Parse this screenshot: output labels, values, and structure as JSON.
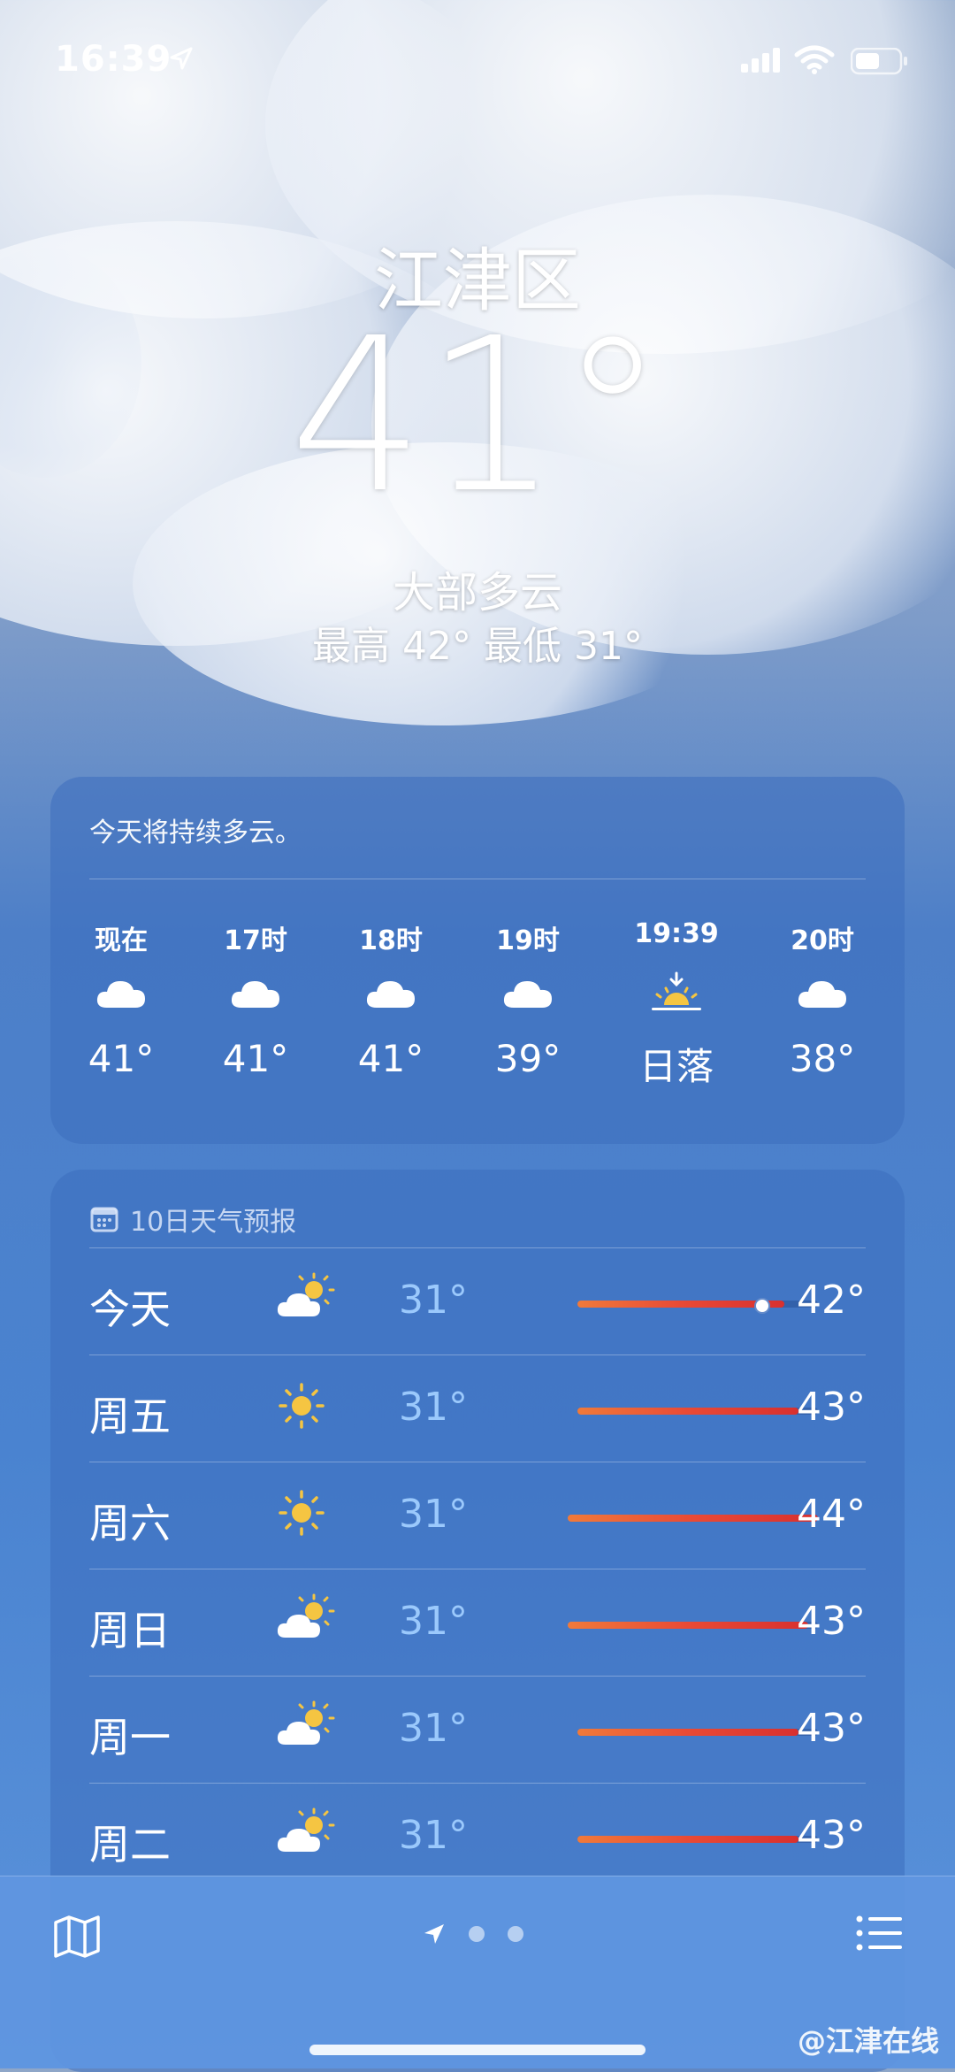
{
  "status_bar": {
    "time": "16:39"
  },
  "header": {
    "city": "江津区",
    "temperature": "41°",
    "condition": "大部多云",
    "high_low": "最高 42°  最低 31°"
  },
  "hourly": {
    "summary": "今天将持续多云。",
    "items": [
      {
        "label": "现在",
        "icon": "cloud-icon",
        "value": "41°"
      },
      {
        "label": "17时",
        "icon": "cloud-icon",
        "value": "41°"
      },
      {
        "label": "18时",
        "icon": "cloud-icon",
        "value": "41°"
      },
      {
        "label": "19时",
        "icon": "cloud-icon",
        "value": "39°"
      },
      {
        "label": "19:39",
        "icon": "sunset-icon",
        "value": "日落"
      },
      {
        "label": "20时",
        "icon": "cloud-icon",
        "value": "38°"
      }
    ]
  },
  "forecast": {
    "title": "10日天气预报",
    "days": [
      {
        "day": "今天",
        "icon": "partly-cloudy-icon",
        "low": "31°",
        "high": "42°",
        "range_start": 0.0,
        "range_end": 0.86,
        "now_marker": 0.76
      },
      {
        "day": "周五",
        "icon": "sun-icon",
        "low": "31°",
        "high": "43°",
        "range_start": 0.0,
        "range_end": 0.92
      },
      {
        "day": "周六",
        "icon": "sun-icon",
        "low": "31°",
        "high": "44°",
        "range_start": -0.04,
        "range_end": 1.0
      },
      {
        "day": "周日",
        "icon": "partly-cloudy-icon",
        "low": "31°",
        "high": "43°",
        "range_start": -0.04,
        "range_end": 0.96
      },
      {
        "day": "周一",
        "icon": "partly-cloudy-icon",
        "low": "31°",
        "high": "43°",
        "range_start": 0.0,
        "range_end": 0.92
      },
      {
        "day": "周二",
        "icon": "partly-cloudy-icon",
        "low": "31°",
        "high": "43°",
        "range_start": 0.0,
        "range_end": 0.92
      }
    ]
  },
  "watermark": "@江津在线"
}
